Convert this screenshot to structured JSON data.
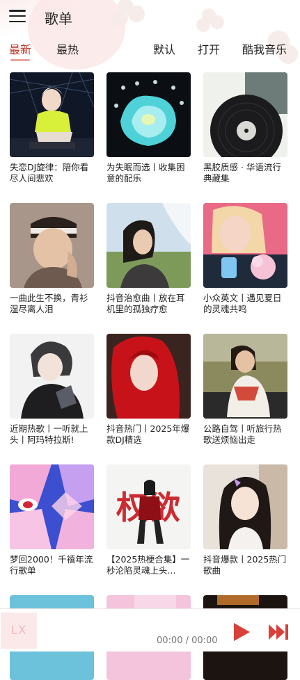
{
  "header": {
    "title": "歌单",
    "menu_icon": "hamburger-menu-icon"
  },
  "tabs": [
    {
      "label": "最新",
      "active": true
    },
    {
      "label": "最热",
      "active": false
    }
  ],
  "sort_options": [
    {
      "label": "默认"
    },
    {
      "label": "打开"
    },
    {
      "label": "酷我音乐"
    }
  ],
  "playlists": [
    {
      "title": "失恋DJ旋律：陪你看尽人间悲欢"
    },
    {
      "title": "为失眠而选丨收集困意的配乐"
    },
    {
      "title": "黑胶质感 · 华语流行典藏集"
    },
    {
      "title": "一曲此生不换，青衫湿尽离人泪"
    },
    {
      "title": "抖音治愈曲丨放在耳机里的孤独疗愈"
    },
    {
      "title": "小众英文丨遇见夏日的灵魂共鸣"
    },
    {
      "title": "近期热歌丨一听就上头丨阿玛特拉斯!"
    },
    {
      "title": "抖音热门丨2025年爆款DJ精选"
    },
    {
      "title": "公路自驾丨听旅行热歌送烦恼出走"
    },
    {
      "title": "梦回2000！千禧年流行歌单"
    },
    {
      "title": "【2025热梗合集】一秒沦陷灵魂上头..."
    },
    {
      "title": "抖音爆款丨2025热门歌曲"
    }
  ],
  "cover_overlay_text": "权欲",
  "player": {
    "logo": "LX",
    "time": "00:00 / 00:00",
    "play_icon": "play-icon",
    "next_icon": "skip-next-icon",
    "accent": "#d9403a"
  },
  "colors": {
    "accent": "#c0392b",
    "tab_underline": "#e5a59e"
  }
}
